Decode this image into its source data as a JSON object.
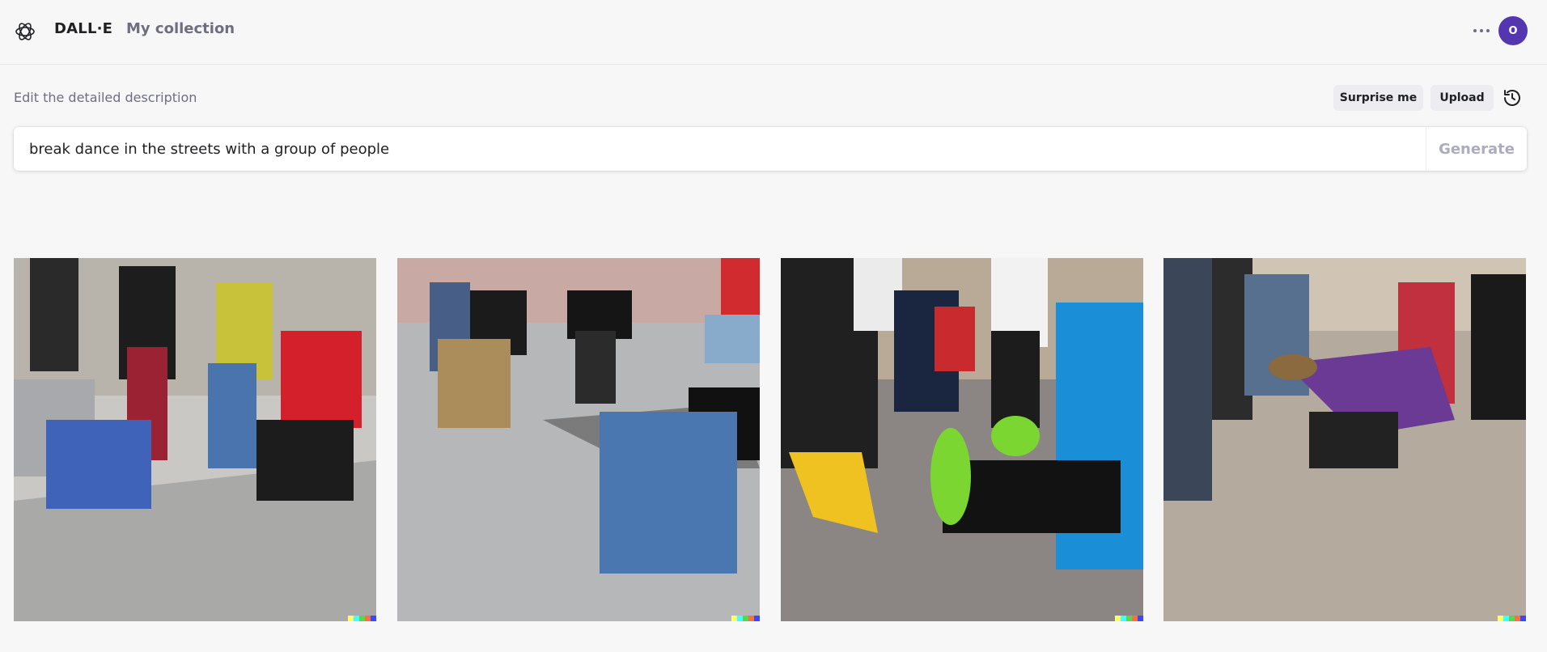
{
  "header": {
    "brand": "DALL·E",
    "collection_link": "My collection",
    "avatar_initial": "O",
    "avatar_color": "#5436b1"
  },
  "editor": {
    "label": "Edit the detailed description",
    "surprise_label": "Surprise me",
    "upload_label": "Upload",
    "prompt_value": "break dance in the streets with a group of people",
    "generate_label": "Generate"
  },
  "results": {
    "images": [
      {
        "id": 1,
        "subject": "break dancers on tiled street, dancer in red jacket"
      },
      {
        "id": 2,
        "subject": "dancers on grey plaza, dancer in blue jeans bending back"
      },
      {
        "id": 3,
        "subject": "dancer in blue shirt with green sneakers on asphalt"
      },
      {
        "id": 4,
        "subject": "dancer in purple doing a freeze on pavement"
      }
    ],
    "watermark_colors": [
      "#ffff66",
      "#42ffff",
      "#51da4c",
      "#ff6e3c",
      "#3c46ff"
    ]
  }
}
